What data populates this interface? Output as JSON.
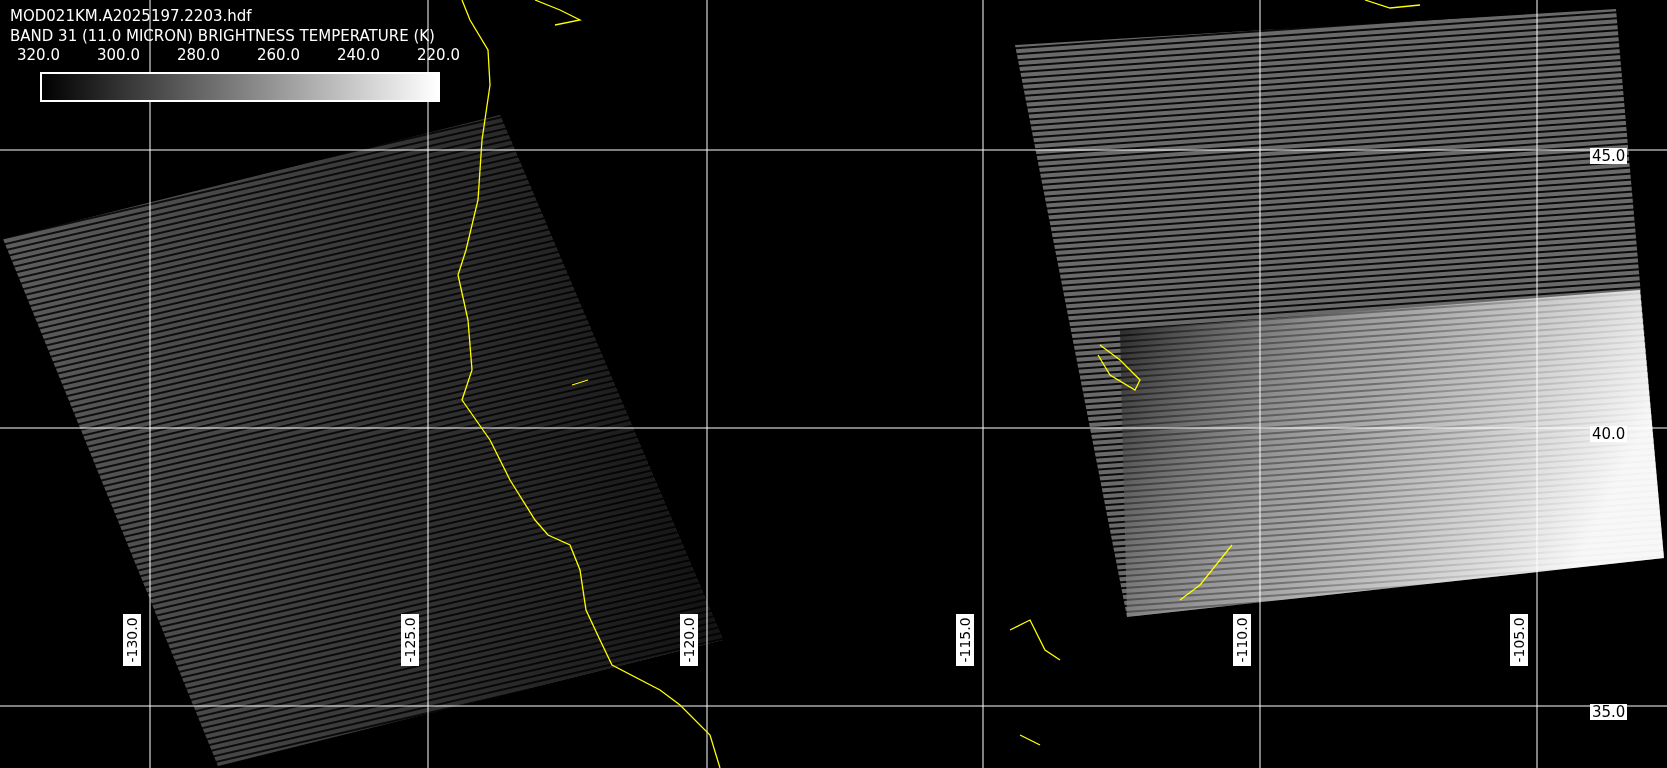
{
  "file_name": "MOD021KM.A2025197.2203.hdf",
  "band_label": "BAND 31 (11.0 MICRON) BRIGHTNESS TEMPERATURE (K)",
  "colorbar": {
    "ticks": [
      "320.0",
      "300.0",
      "280.0",
      "260.0",
      "240.0",
      "220.0"
    ]
  },
  "longitude_labels": [
    "-130.0",
    "-125.0",
    "-120.0",
    "-115.0",
    "-110.0",
    "-105.0"
  ],
  "latitude_labels": [
    "45.0",
    "40.0",
    "35.0"
  ]
}
